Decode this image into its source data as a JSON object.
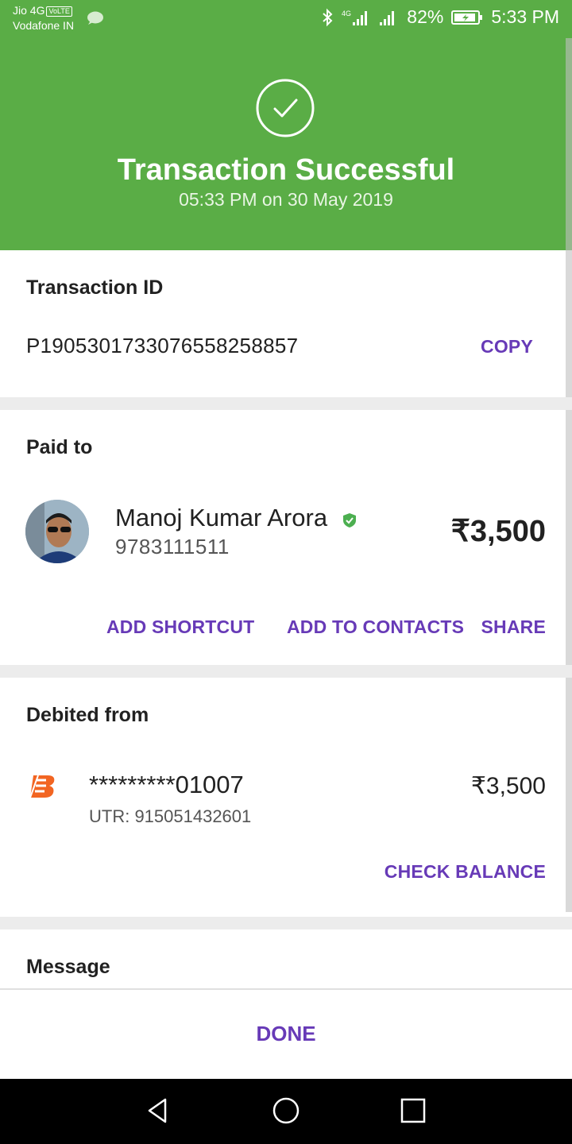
{
  "status_bar": {
    "carrier_1": "Jio 4G",
    "volte": "VoLTE",
    "carrier_2": "Vodafone IN",
    "network_1": "4G",
    "battery": "82%",
    "time": "5:33 PM"
  },
  "header": {
    "title": "Transaction Successful",
    "subtitle": "05:33 PM on 30 May 2019",
    "icon": "check-circle-icon"
  },
  "transaction": {
    "label": "Transaction ID",
    "id": "P1905301733076558258857",
    "copy_label": "COPY"
  },
  "paid_to": {
    "label": "Paid to",
    "name": "Manoj Kumar Arora",
    "phone": "9783111511",
    "amount": "₹3,500",
    "actions": {
      "add_shortcut": "ADD SHORTCUT",
      "add_to_contacts": "ADD TO CONTACTS",
      "share": "SHARE"
    }
  },
  "debited_from": {
    "label": "Debited from",
    "account": "*********01007",
    "utr": "UTR: 915051432601",
    "amount": "₹3,500",
    "check_balance": "CHECK BALANCE"
  },
  "message": {
    "label": "Message"
  },
  "footer": {
    "done_label": "DONE"
  },
  "colors": {
    "success_green": "#5aad46",
    "accent_purple": "#673ab7",
    "verified_green": "#4caf50",
    "bank_orange": "#f26522"
  }
}
